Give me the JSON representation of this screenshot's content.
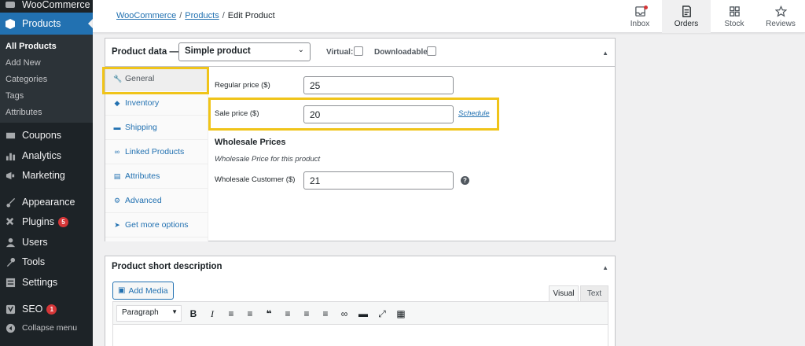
{
  "sidebar": {
    "woocommerce": "WooCommerce",
    "products": "Products",
    "submenu": [
      "All Products",
      "Add New",
      "Categories",
      "Tags",
      "Attributes"
    ],
    "items": [
      {
        "label": "Coupons",
        "icon": "ticket-icon"
      },
      {
        "label": "Analytics",
        "icon": "bar-chart-icon"
      },
      {
        "label": "Marketing",
        "icon": "megaphone-icon"
      },
      {
        "label": "Appearance",
        "icon": "paintbrush-icon"
      },
      {
        "label": "Plugins",
        "icon": "plug-icon",
        "badge": "5"
      },
      {
        "label": "Users",
        "icon": "user-icon"
      },
      {
        "label": "Tools",
        "icon": "wrench-icon"
      },
      {
        "label": "Settings",
        "icon": "settings-icon"
      },
      {
        "label": "SEO",
        "icon": "yoast-icon",
        "badge": "1"
      },
      {
        "label": "Collapse menu",
        "icon": "collapse-icon"
      }
    ]
  },
  "breadcrumb": {
    "root": "WooCommerce",
    "section": "Products",
    "current": "Edit Product",
    "sep": "/"
  },
  "topbar": {
    "inbox": "Inbox",
    "orders": "Orders",
    "stock": "Stock",
    "reviews": "Reviews"
  },
  "product_data": {
    "title": "Product data —",
    "type": "Simple product",
    "virtual_label": "Virtual:",
    "downloadable_label": "Downloadable:",
    "virtual_checked": false,
    "downloadable_checked": false,
    "tabs": [
      {
        "label": "General",
        "icon": "wrench-icon"
      },
      {
        "label": "Inventory",
        "icon": "tag-icon"
      },
      {
        "label": "Shipping",
        "icon": "truck-icon"
      },
      {
        "label": "Linked Products",
        "icon": "link-icon"
      },
      {
        "label": "Attributes",
        "icon": "list-icon"
      },
      {
        "label": "Advanced",
        "icon": "gear-icon"
      },
      {
        "label": "Get more options",
        "icon": "plugin-icon"
      }
    ],
    "regular_price_label": "Regular price ($)",
    "regular_price": "25",
    "sale_price_label": "Sale price ($)",
    "sale_price": "20",
    "schedule_link": "Schedule",
    "wholesale_title": "Wholesale Prices",
    "wholesale_desc": "Wholesale Price for this product",
    "wholesale_customer_label": "Wholesale Customer ($)",
    "wholesale_customer_price": "21"
  },
  "short_description": {
    "title": "Product short description",
    "add_media": "Add Media",
    "tab_visual": "Visual",
    "tab_text": "Text",
    "format": "Paragraph"
  },
  "colors": {
    "accent": "#2271b1",
    "sidebar": "#1d2327",
    "highlight": "#f0c419"
  }
}
